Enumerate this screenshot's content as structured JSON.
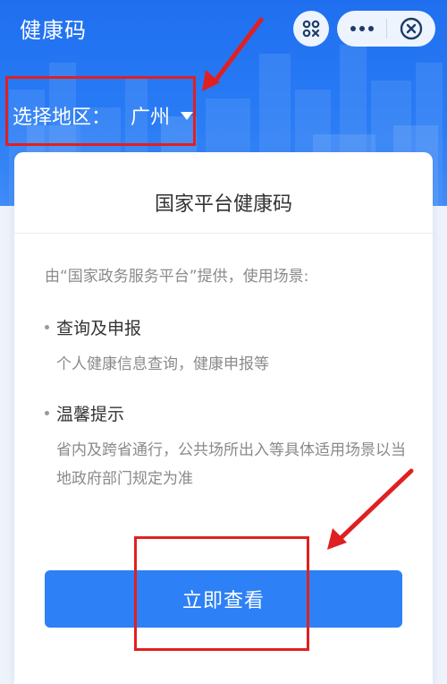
{
  "header": {
    "title": "健康码",
    "scan_icon": "scan-code-icon",
    "more_icon": "more-dots-icon",
    "close_icon": "close-circle-icon"
  },
  "region": {
    "label": "选择地区：",
    "city": "广州"
  },
  "card": {
    "title": "国家平台健康码",
    "intro": "由“国家政务服务平台”提供，使用场景:",
    "sections": [
      {
        "title": "查询及申报",
        "desc": "个人健康信息查询，健康申报等"
      },
      {
        "title": "温馨提示",
        "desc": "省内及跨省通行，公共场所出入等具体适用场景以当地政府部门规定为准"
      }
    ],
    "button_label": "立即查看"
  },
  "colors": {
    "primary": "#2d80f6",
    "header_blue": "#1f6ff0",
    "annotation_red": "#e02020"
  }
}
